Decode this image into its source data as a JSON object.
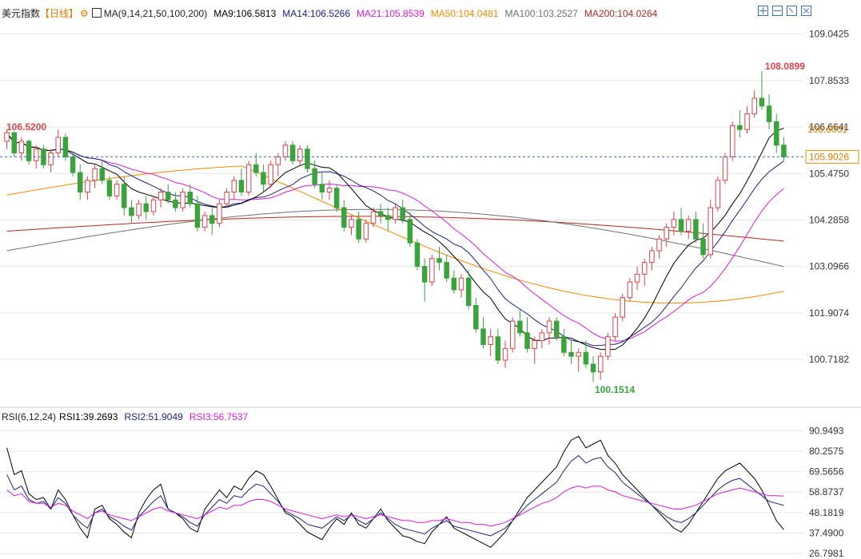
{
  "header": {
    "symbol": "美元指数",
    "period": "【日线】",
    "gear_icon": "gear-icon",
    "ma_icon": "chart-icon",
    "ma_params": "MA(9,14,21,50,100,200)",
    "ma9": "MA9:106.5813",
    "ma14": "MA14:106.5266",
    "ma21": "MA21:105.8539",
    "ma50": "MA50:104.0481",
    "ma100": "MA100:103.2527",
    "ma200": "MA200:104.0264"
  },
  "rsi_header": {
    "params": "RSI(6,12,24)",
    "rsi1": "RSI1:39.2693",
    "rsi2": "RSI2:51.9049",
    "rsi3": "RSI3:56.7537"
  },
  "colors": {
    "up": "#d9434b",
    "down": "#3aa33c",
    "ma9": "#000000",
    "ma14": "#1a237e",
    "ma21": "#d81bd8",
    "ma50": "#f08a00",
    "ma100": "#707070",
    "ma200": "#b02a1f",
    "grid": "#e6e6e6",
    "dash": "#3b6fb6"
  },
  "chart_data": [
    {
      "type": "candlestick",
      "title": "美元指数【日线】",
      "y_ticks": [
        "109.0425",
        "107.8533",
        "106.6641",
        "105.4750",
        "104.2858",
        "103.0966",
        "101.9074",
        "100.7182"
      ],
      "ylim": [
        99.7,
        109.3
      ],
      "current_price": "105.9026",
      "ma21_marker": "106.6001",
      "annotations": {
        "high": "108.0899",
        "low": "100.1514",
        "left_high": "106.5200"
      },
      "legend": "top-left",
      "grid": true,
      "ohlc": [
        [
          106.3,
          106.6,
          106.1,
          106.52
        ],
        [
          106.52,
          106.55,
          105.9,
          106.0
        ],
        [
          106.0,
          106.4,
          105.8,
          106.3
        ],
        [
          106.3,
          106.35,
          105.7,
          105.8
        ],
        [
          105.8,
          106.2,
          105.6,
          106.1
        ],
        [
          106.1,
          106.2,
          105.6,
          105.7
        ],
        [
          105.7,
          106.1,
          105.5,
          106.0
        ],
        [
          106.0,
          106.6,
          105.9,
          106.4
        ],
        [
          106.4,
          106.5,
          105.8,
          105.9
        ],
        [
          105.9,
          106.0,
          105.4,
          105.5
        ],
        [
          105.5,
          105.7,
          104.8,
          105.0
        ],
        [
          105.0,
          105.4,
          104.8,
          105.3
        ],
        [
          105.3,
          105.7,
          105.1,
          105.6
        ],
        [
          105.6,
          105.8,
          105.2,
          105.3
        ],
        [
          105.3,
          105.4,
          104.8,
          104.9
        ],
        [
          104.9,
          105.3,
          104.8,
          105.2
        ],
        [
          105.2,
          105.4,
          104.4,
          104.6
        ],
        [
          104.6,
          104.8,
          104.2,
          104.4
        ],
        [
          104.4,
          104.8,
          104.3,
          104.7
        ],
        [
          104.7,
          104.9,
          104.3,
          104.5
        ],
        [
          104.5,
          104.9,
          104.4,
          104.8
        ],
        [
          104.8,
          105.1,
          104.6,
          105.0
        ],
        [
          105.0,
          105.2,
          104.7,
          104.8
        ],
        [
          104.8,
          105.0,
          104.5,
          104.6
        ],
        [
          104.6,
          105.1,
          104.5,
          105.0
        ],
        [
          105.0,
          105.2,
          104.6,
          104.7
        ],
        [
          104.7,
          104.9,
          104.0,
          104.1
        ],
        [
          104.1,
          104.5,
          104.0,
          104.4
        ],
        [
          104.4,
          104.6,
          103.9,
          104.2
        ],
        [
          104.2,
          104.8,
          104.1,
          104.7
        ],
        [
          104.7,
          105.1,
          104.6,
          105.0
        ],
        [
          105.0,
          105.4,
          104.8,
          105.3
        ],
        [
          105.3,
          105.6,
          104.9,
          105.0
        ],
        [
          105.0,
          105.8,
          104.9,
          105.7
        ],
        [
          105.7,
          106.0,
          105.4,
          105.5
        ],
        [
          105.5,
          105.7,
          105.0,
          105.2
        ],
        [
          105.2,
          105.8,
          105.1,
          105.7
        ],
        [
          105.7,
          106.0,
          105.4,
          105.9
        ],
        [
          105.9,
          106.3,
          105.8,
          106.2
        ],
        [
          106.2,
          106.3,
          105.7,
          105.8
        ],
        [
          105.8,
          106.2,
          105.7,
          106.1
        ],
        [
          106.1,
          106.2,
          105.5,
          105.6
        ],
        [
          105.6,
          105.8,
          105.1,
          105.2
        ],
        [
          105.2,
          105.5,
          104.8,
          105.0
        ],
        [
          105.0,
          105.3,
          104.8,
          105.1
        ],
        [
          105.1,
          105.2,
          104.5,
          104.6
        ],
        [
          104.6,
          104.8,
          104.0,
          104.1
        ],
        [
          104.1,
          104.4,
          103.9,
          104.3
        ],
        [
          104.3,
          104.5,
          103.7,
          103.8
        ],
        [
          103.8,
          104.3,
          103.7,
          104.2
        ],
        [
          104.2,
          104.6,
          104.1,
          104.5
        ],
        [
          104.5,
          104.7,
          104.2,
          104.4
        ],
        [
          104.4,
          104.6,
          104.0,
          104.3
        ],
        [
          104.3,
          104.7,
          104.2,
          104.6
        ],
        [
          104.6,
          104.8,
          104.2,
          104.3
        ],
        [
          104.3,
          104.5,
          103.6,
          103.7
        ],
        [
          103.7,
          103.8,
          103.0,
          103.1
        ],
        [
          103.1,
          103.3,
          102.2,
          102.7
        ],
        [
          102.7,
          103.4,
          102.6,
          103.3
        ],
        [
          103.3,
          103.6,
          103.0,
          103.2
        ],
        [
          103.2,
          103.4,
          102.7,
          102.8
        ],
        [
          102.8,
          103.0,
          102.4,
          102.5
        ],
        [
          102.5,
          102.9,
          102.3,
          102.8
        ],
        [
          102.8,
          103.0,
          102.0,
          102.1
        ],
        [
          102.1,
          102.3,
          101.4,
          101.5
        ],
        [
          101.5,
          101.8,
          101.0,
          101.1
        ],
        [
          101.1,
          101.5,
          100.8,
          101.3
        ],
        [
          101.3,
          101.5,
          100.6,
          100.7
        ],
        [
          100.7,
          101.2,
          100.5,
          101.0
        ],
        [
          101.0,
          101.8,
          100.9,
          101.7
        ],
        [
          101.7,
          102.0,
          101.3,
          101.4
        ],
        [
          101.4,
          101.8,
          100.9,
          101.0
        ],
        [
          101.0,
          101.3,
          100.6,
          101.2
        ],
        [
          101.2,
          101.5,
          101.0,
          101.4
        ],
        [
          101.4,
          101.8,
          101.1,
          101.7
        ],
        [
          101.7,
          101.8,
          101.2,
          101.3
        ],
        [
          101.3,
          101.5,
          100.8,
          100.9
        ],
        [
          100.9,
          101.2,
          100.6,
          100.8
        ],
        [
          100.8,
          101.0,
          100.4,
          100.9
        ],
        [
          100.9,
          101.2,
          100.5,
          100.6
        ],
        [
          100.6,
          100.8,
          100.15,
          100.4
        ],
        [
          100.4,
          100.9,
          100.2,
          100.8
        ],
        [
          100.8,
          101.4,
          100.7,
          101.3
        ],
        [
          101.3,
          101.9,
          101.2,
          101.8
        ],
        [
          101.8,
          102.4,
          101.7,
          102.3
        ],
        [
          102.3,
          102.8,
          102.2,
          102.7
        ],
        [
          102.7,
          103.1,
          102.5,
          102.9
        ],
        [
          102.9,
          103.3,
          102.6,
          103.2
        ],
        [
          103.2,
          103.6,
          103.0,
          103.5
        ],
        [
          103.5,
          103.9,
          103.3,
          103.8
        ],
        [
          103.8,
          104.2,
          103.6,
          104.1
        ],
        [
          104.1,
          104.5,
          103.9,
          104.3
        ],
        [
          104.3,
          104.6,
          103.9,
          104.0
        ],
        [
          104.0,
          104.4,
          103.8,
          104.3
        ],
        [
          104.3,
          104.5,
          103.7,
          103.8
        ],
        [
          103.8,
          104.2,
          103.3,
          103.4
        ],
        [
          103.4,
          104.8,
          103.3,
          104.6
        ],
        [
          104.6,
          105.4,
          104.5,
          105.3
        ],
        [
          105.3,
          106.0,
          105.2,
          105.9
        ],
        [
          105.9,
          106.8,
          105.8,
          106.7
        ],
        [
          106.7,
          107.1,
          106.4,
          106.6
        ],
        [
          106.6,
          107.2,
          106.5,
          107.0
        ],
        [
          107.0,
          107.6,
          106.9,
          107.4
        ],
        [
          107.4,
          108.09,
          107.1,
          107.2
        ],
        [
          107.2,
          107.5,
          106.6,
          106.8
        ],
        [
          106.8,
          107.0,
          106.0,
          106.2
        ],
        [
          106.2,
          106.4,
          105.8,
          105.9
        ]
      ]
    },
    {
      "type": "line",
      "title": "RSI(6,12,24)",
      "y_ticks": [
        "90.9493",
        "80.2575",
        "69.5656",
        "58.8737",
        "48.1819",
        "37.4900",
        "26.7981"
      ],
      "ylim": [
        26.0,
        94.0
      ],
      "series": [
        {
          "name": "RSI1",
          "values": [
            82,
            68,
            70,
            58,
            55,
            56,
            50,
            60,
            55,
            47,
            40,
            35,
            50,
            52,
            45,
            42,
            38,
            35,
            48,
            55,
            60,
            63,
            50,
            48,
            45,
            40,
            38,
            50,
            55,
            60,
            56,
            62,
            60,
            66,
            70,
            68,
            62,
            55,
            48,
            46,
            42,
            38,
            36,
            34,
            40,
            45,
            42,
            48,
            42,
            40,
            45,
            50,
            44,
            40,
            36,
            35,
            33,
            32,
            38,
            42,
            46,
            40,
            38,
            36,
            34,
            32,
            30,
            34,
            38,
            44,
            50,
            56,
            60,
            64,
            68,
            72,
            80,
            86,
            88,
            82,
            84,
            86,
            78,
            74,
            68,
            64,
            60,
            56,
            52,
            48,
            44,
            40,
            38,
            42,
            48,
            54,
            60,
            66,
            70,
            72,
            74,
            70,
            66,
            60,
            52,
            44,
            39.27
          ]
        },
        {
          "name": "RSI2",
          "values": [
            68,
            60,
            62,
            55,
            53,
            54,
            50,
            56,
            53,
            47,
            43,
            40,
            48,
            50,
            46,
            44,
            41,
            39,
            46,
            50,
            54,
            57,
            50,
            48,
            46,
            43,
            41,
            47,
            51,
            55,
            53,
            57,
            56,
            60,
            63,
            62,
            58,
            54,
            49,
            47,
            45,
            42,
            41,
            40,
            43,
            46,
            44,
            47,
            44,
            42,
            45,
            48,
            45,
            42,
            40,
            39,
            38,
            37,
            40,
            42,
            44,
            41,
            40,
            39,
            38,
            37,
            36,
            38,
            40,
            44,
            48,
            52,
            55,
            58,
            61,
            64,
            70,
            75,
            78,
            74,
            76,
            77,
            72,
            69,
            64,
            61,
            58,
            55,
            52,
            49,
            46,
            44,
            43,
            45,
            48,
            52,
            56,
            60,
            63,
            65,
            66,
            63,
            60,
            57,
            54,
            53,
            51.9
          ]
        },
        {
          "name": "RSI3",
          "values": [
            60,
            57,
            58,
            54,
            53,
            53,
            51,
            53,
            52,
            49,
            47,
            45,
            48,
            49,
            47,
            46,
            45,
            44,
            46,
            48,
            50,
            51,
            49,
            48,
            47,
            46,
            45,
            47,
            49,
            51,
            50,
            52,
            52,
            54,
            55,
            55,
            54,
            52,
            50,
            49,
            48,
            47,
            46,
            45,
            46,
            47,
            46,
            47,
            46,
            45,
            46,
            47,
            46,
            45,
            44,
            44,
            43,
            43,
            44,
            44,
            45,
            44,
            43,
            43,
            42,
            42,
            41,
            42,
            43,
            45,
            47,
            49,
            51,
            53,
            54,
            56,
            59,
            61,
            62,
            61,
            62,
            62,
            60,
            59,
            57,
            56,
            55,
            54,
            53,
            52,
            51,
            50,
            50,
            51,
            52,
            54,
            56,
            58,
            59,
            60,
            61,
            60,
            59,
            58,
            57,
            57,
            56.75
          ]
        }
      ]
    }
  ]
}
